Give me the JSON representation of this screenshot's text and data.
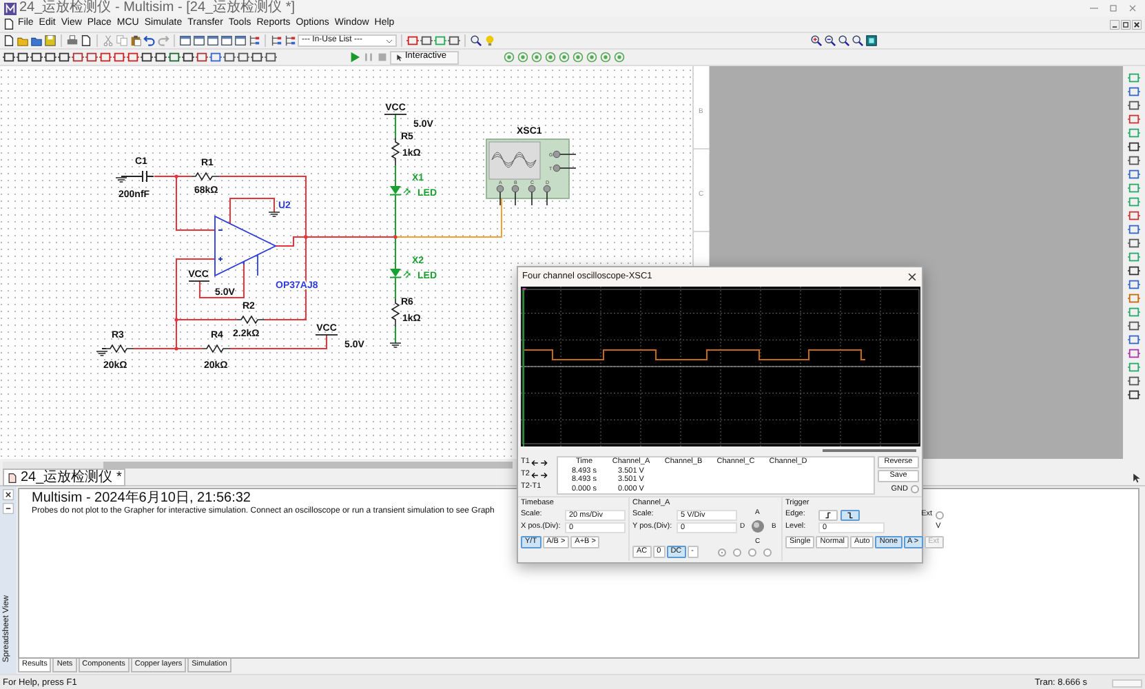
{
  "window": {
    "title": "24_运放检测仪 - Multisim - [24_运放检测仪 *]"
  },
  "menu": [
    "File",
    "Edit",
    "View",
    "Place",
    "MCU",
    "Simulate",
    "Transfer",
    "Tools",
    "Reports",
    "Options",
    "Window",
    "Help"
  ],
  "toolbar": {
    "in_use_list": "--- In-Use List ---",
    "mode_button": "Interactive"
  },
  "schematic": {
    "parts": [
      {
        "kind": "capacitor",
        "ref": "C1",
        "value": "200nfF"
      },
      {
        "kind": "resistor",
        "ref": "R1",
        "value": "68kΩ"
      },
      {
        "kind": "opamp",
        "ref": "U2",
        "value": "OP37AJ8"
      },
      {
        "kind": "vcc",
        "ref": "VCC",
        "value": "5.0V"
      },
      {
        "kind": "vcc",
        "ref": "VCC",
        "value": "5.0V"
      },
      {
        "kind": "vcc",
        "ref": "VCC",
        "value": "5.0V"
      },
      {
        "kind": "resistor",
        "ref": "R2",
        "value": "2.2kΩ"
      },
      {
        "kind": "resistor",
        "ref": "R3",
        "value": "20kΩ"
      },
      {
        "kind": "resistor",
        "ref": "R4",
        "value": "20kΩ"
      },
      {
        "kind": "resistor",
        "ref": "R5",
        "value": "1kΩ"
      },
      {
        "kind": "led",
        "ref": "X1",
        "value": "LED"
      },
      {
        "kind": "led",
        "ref": "X2",
        "value": "LED"
      },
      {
        "kind": "resistor",
        "ref": "R6",
        "value": "1kΩ"
      },
      {
        "kind": "scope",
        "ref": "XSC1",
        "pins": [
          "G",
          "T",
          "A",
          "B",
          "C",
          "D"
        ]
      }
    ],
    "border_marks": [
      "B",
      "C"
    ]
  },
  "oscilloscope": {
    "title": "Four channel oscilloscope-XSC1",
    "cursor_rows": [
      {
        "kind": "cursor",
        "label": "T1"
      },
      {
        "kind": "cursor",
        "label": "T2"
      },
      {
        "kind": "difference",
        "label": "T2-T1"
      }
    ],
    "columns": [
      "Time",
      "Channel_A",
      "Channel_B",
      "Channel_C",
      "Channel_D"
    ],
    "rows": [
      [
        "8.493 s",
        "3.501 V"
      ],
      [
        "8.493 s",
        "3.501 V"
      ],
      [
        "0.000 s",
        "0.000 V"
      ]
    ],
    "side_buttons": [
      "Reverse",
      "Save"
    ],
    "gnd": {
      "label": "GND",
      "checked": false
    },
    "timebase": {
      "title": "Timebase",
      "fields": [
        {
          "label": "Scale:",
          "value": "20 ms/Div"
        },
        {
          "label": "X pos.(Div):",
          "value": "0"
        }
      ],
      "buttons": [
        {
          "label": "Y/T",
          "selected": true
        },
        {
          "label": "A/B >",
          "selected": false
        },
        {
          "label": "A+B >",
          "selected": false
        }
      ]
    },
    "channel": {
      "title": "Channel_A",
      "fields": [
        {
          "label": "Scale:",
          "value": "5  V/Div"
        },
        {
          "label": "Y pos.(Div):",
          "value": "0"
        }
      ],
      "knob_labels": [
        "A",
        "B",
        "C",
        "D"
      ],
      "buttons": [
        {
          "label": "AC",
          "selected": false
        },
        {
          "label": "0",
          "selected": false
        },
        {
          "label": "DC",
          "selected": true
        },
        {
          "label": "-",
          "selected": false
        }
      ],
      "radios": [
        {
          "checked": true
        },
        {
          "checked": false
        },
        {
          "checked": false
        },
        {
          "checked": false
        }
      ]
    },
    "trigger": {
      "title": "Trigger",
      "edge_label": "Edge:",
      "edges": [
        {
          "kind": "rising",
          "selected": false
        },
        {
          "kind": "falling",
          "selected": true
        }
      ],
      "ext": {
        "label": "Ext",
        "checked": false
      },
      "level": {
        "label": "Level:",
        "value": "0",
        "unit": "V"
      },
      "buttons": [
        {
          "label": "Single",
          "selected": false,
          "disabled": false
        },
        {
          "label": "Normal",
          "selected": false,
          "disabled": false
        },
        {
          "label": "Auto",
          "selected": false,
          "disabled": false
        },
        {
          "label": "None",
          "selected": true,
          "disabled": false
        },
        {
          "label": "A >",
          "selected": true,
          "disabled": false
        },
        {
          "label": "Ext",
          "selected": false,
          "disabled": true
        }
      ]
    }
  },
  "design_tabs": [
    {
      "label": "24_运放检测仪 *",
      "selected": true
    }
  ],
  "spreadsheet": {
    "title": "Spreadsheet View",
    "messages": [
      {
        "kind": "header",
        "text": "Multisim  -  2024年6月10日, 21:56:32"
      },
      {
        "kind": "body",
        "text": "Probes do not plot to the Grapher for interactive simulation. Connect an oscilloscope or run a transient simulation to see Graph"
      }
    ],
    "tabs": [
      {
        "label": "Results",
        "selected": true
      },
      {
        "label": "Nets",
        "selected": false
      },
      {
        "label": "Components",
        "selected": false
      },
      {
        "label": "Copper layers",
        "selected": false
      },
      {
        "label": "Simulation",
        "selected": false
      }
    ]
  },
  "status_bar": {
    "help": "For Help, press F1",
    "simulation": "Tran: 8.666 s"
  }
}
